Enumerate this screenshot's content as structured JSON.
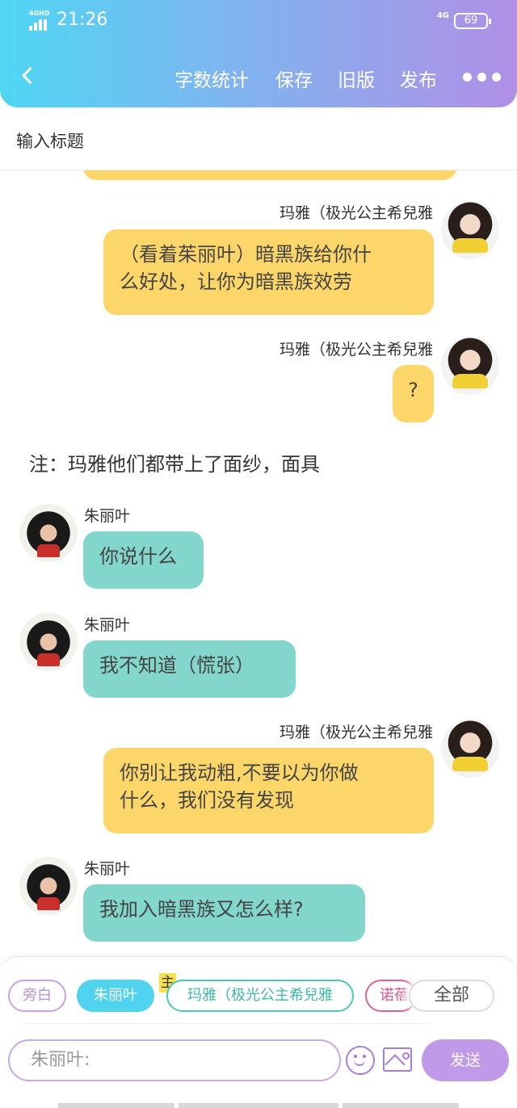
{
  "status_bar": {
    "network_tag": "4GHD",
    "time": "21:26",
    "network": "4G",
    "battery": "69"
  },
  "header": {
    "word_count_label": "字数统计",
    "save_label": "保存",
    "old_version_label": "旧版",
    "publish_label": "发布"
  },
  "title_field": {
    "placeholder": "输入标题"
  },
  "messages": [
    {
      "speaker": "玛雅（极光公主希兒雅",
      "text": "（看着茱丽叶）暗黑族给你什么好处，让你为暗黑族效劳",
      "line1": "（看着茱丽叶）暗黑族给你什",
      "line2": "么好处，让你为暗黑族效劳"
    },
    {
      "speaker": "玛雅（极光公主希兒雅",
      "text": "?"
    },
    {
      "speaker": "朱丽叶",
      "text": "你说什么"
    },
    {
      "speaker": "朱丽叶",
      "text": "我不知道（慌张）"
    },
    {
      "speaker": "玛雅（极光公主希兒雅",
      "text": "你别让我动粗,不要以为你做什么，我们没有发现",
      "line1": "你别让我动粗,不要以为你做",
      "line2": "什么，我们没有发现"
    },
    {
      "speaker": "朱丽叶",
      "text": "我加入暗黑族又怎么样?"
    }
  ],
  "note": {
    "text": "注：玛雅他们都带上了面纱，面具"
  },
  "role_chips": {
    "narrator": "旁白",
    "juliet": "朱丽叶",
    "maya": "玛雅（极光公主希兒雅",
    "nuo": "诺蓓",
    "all": "全部",
    "main_badge": "主"
  },
  "composer": {
    "placeholder": "朱丽叶:",
    "send_label": "发送"
  },
  "colors": {
    "header_start": "#4fd6f4",
    "header_end": "#b08fe6",
    "bubble_yellow": "#fdd66a",
    "bubble_teal": "#82d6cc",
    "accent_purple": "#c09ae8"
  }
}
